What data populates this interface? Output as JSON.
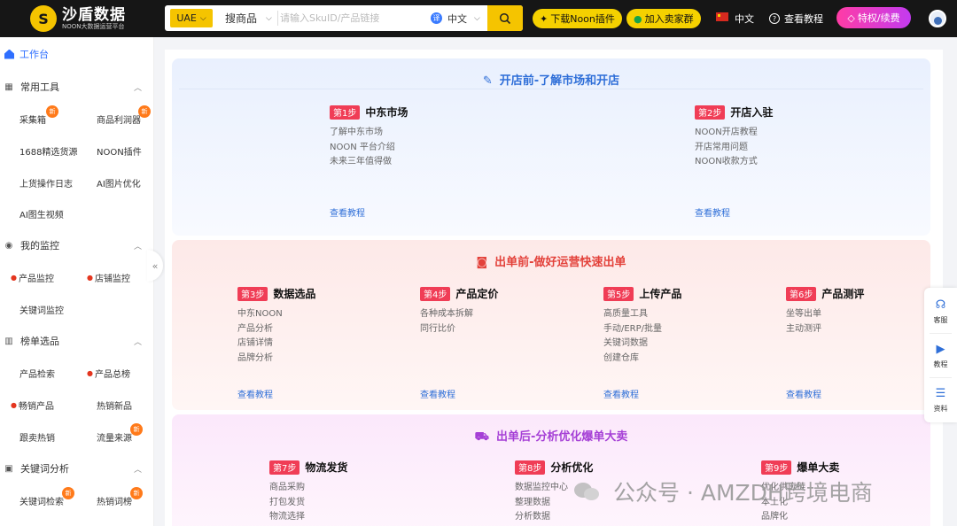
{
  "header": {
    "logo_title": "沙盾数据",
    "logo_sub": "NOON大数据运营平台",
    "country": "UAE",
    "search_type": "搜商品",
    "search_placeholder": "请输入SkuID/产品链接",
    "search_lang": "中文",
    "btn_download": "下载Noon插件",
    "btn_join": "加入卖家群",
    "lang": "中文",
    "tutorial": "查看教程",
    "vip": "特权/续费"
  },
  "sidebar": {
    "home": "工作台",
    "groups": [
      {
        "label": "常用工具",
        "icon": "grid-icon"
      },
      {
        "label": "我的监控",
        "icon": "monitor-icon"
      },
      {
        "label": "榜单选品",
        "icon": "bar-chart-icon"
      },
      {
        "label": "关键词分析",
        "icon": "keyword-icon"
      }
    ],
    "items": [
      {
        "label": "采集箱",
        "new": "新"
      },
      {
        "label": "商品利润器",
        "new": "新"
      },
      {
        "label": "1688精选货源"
      },
      {
        "label": "NOON插件"
      },
      {
        "label": "上货操作日志"
      },
      {
        "label": "AI图片优化"
      },
      {
        "label": "AI图生视频"
      },
      {
        "label": "产品监控"
      },
      {
        "label": "店铺监控"
      },
      {
        "label": "关键词监控"
      },
      {
        "label": "产品检索"
      },
      {
        "label": "产品总榜"
      },
      {
        "label": "畅销产品"
      },
      {
        "label": "热销新品"
      },
      {
        "label": "跟卖热销"
      },
      {
        "label": "流量来源",
        "new": "新"
      },
      {
        "label": "关键词检索",
        "new": "新"
      },
      {
        "label": "热销词榜",
        "new": "新"
      }
    ],
    "collapse": "«"
  },
  "sections": [
    {
      "title": "开店前-了解市场和开店",
      "steps": [
        {
          "badge": "第1步",
          "name": "中东市场",
          "links": [
            "了解中东市场",
            "NOON 平台介绍",
            "未来三年值得做"
          ],
          "tutorial": "查看教程"
        },
        {
          "badge": "第2步",
          "name": "开店入驻",
          "links": [
            "NOON开店教程",
            "开店常用问题",
            "NOON收款方式"
          ],
          "tutorial": "查看教程"
        }
      ]
    },
    {
      "title": "出单前-做好运营快速出单",
      "steps": [
        {
          "badge": "第3步",
          "name": "数据选品",
          "links": [
            "中东NOON",
            "产品分析",
            "店铺详情",
            "品牌分析"
          ],
          "tutorial": "查看教程"
        },
        {
          "badge": "第4步",
          "name": "产品定价",
          "links": [
            "各种成本拆解",
            "同行比价"
          ],
          "tutorial": "查看教程"
        },
        {
          "badge": "第5步",
          "name": "上传产品",
          "links": [
            "高质量工具",
            "手动/ERP/批量",
            "关键词数据",
            "创建仓库"
          ],
          "tutorial": "查看教程"
        },
        {
          "badge": "第6步",
          "name": "产品测评",
          "links": [
            "坐等出单",
            "主动测评"
          ],
          "tutorial": "查看教程"
        }
      ]
    },
    {
      "title": "出单后-分析优化爆单大卖",
      "steps": [
        {
          "badge": "第7步",
          "name": "物流发货",
          "links": [
            "商品采购",
            "打包发货",
            "物流选择"
          ]
        },
        {
          "badge": "第8步",
          "name": "分析优化",
          "links": [
            "数据监控中心",
            "整理数据",
            "分析数据"
          ]
        },
        {
          "badge": "第9步",
          "name": "爆单大卖",
          "links": [
            "优化供应链",
            "本土化",
            "品牌化"
          ]
        }
      ]
    }
  ],
  "float_panel": [
    {
      "label": "客服",
      "icon": "headset-icon"
    },
    {
      "label": "教程",
      "icon": "video-icon"
    },
    {
      "label": "资料",
      "icon": "document-icon"
    }
  ],
  "watermark": "公众号 · AMZDH跨境电商",
  "colors": {
    "brand_yellow": "#f5c400",
    "accent_blue": "#2f6fd8",
    "badge_red": "#f03d56",
    "vip_pink": "#ff3ca5"
  }
}
